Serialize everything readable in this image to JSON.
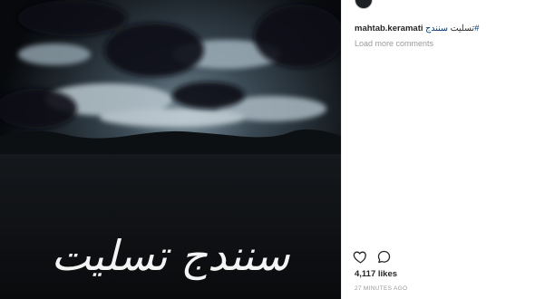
{
  "post": {
    "overlay_text": "سنندج تسلیت"
  },
  "caption": {
    "username": "mahtab.keramati",
    "hashtag": "سنندج#",
    "text": "تسلیت"
  },
  "comments": {
    "load_more_label": "Load more comments"
  },
  "actions": {
    "like_icon": "heart-icon",
    "comment_icon": "comment-bubble-icon"
  },
  "likes": {
    "count_text": "4,117 likes"
  },
  "timestamp": "27 MINUTES AGO",
  "colors": {
    "hashtag": "#003569",
    "secondary_text": "#999999"
  }
}
